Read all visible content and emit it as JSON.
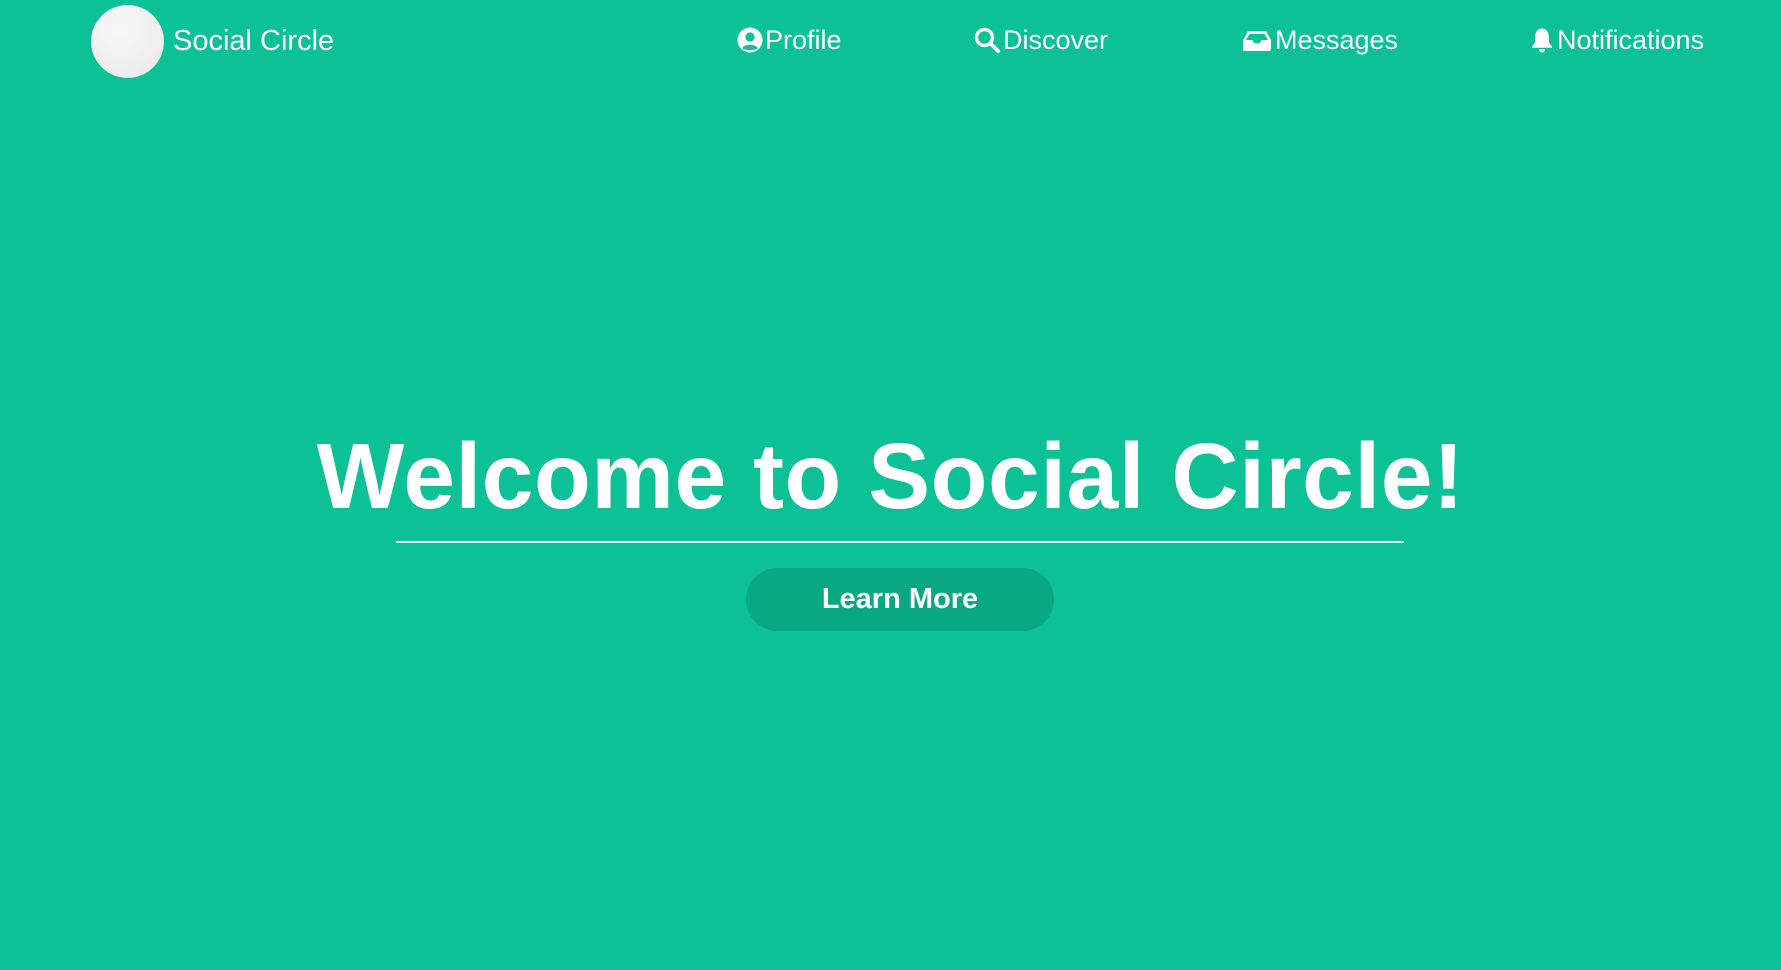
{
  "app": {
    "title": "Social Circle",
    "accent_color": "#0bc195",
    "button_color": "#08a882",
    "logo_icon": "avatar-circle"
  },
  "nav": {
    "items": [
      {
        "label": "Profile",
        "icon": "user-circle-icon"
      },
      {
        "label": "Discover",
        "icon": "search-icon"
      },
      {
        "label": "Messages",
        "icon": "inbox-icon"
      },
      {
        "label": "Notifications",
        "icon": "bell-icon"
      }
    ]
  },
  "hero": {
    "title": "Welcome to Social Circle!",
    "cta_label": "Learn More"
  }
}
